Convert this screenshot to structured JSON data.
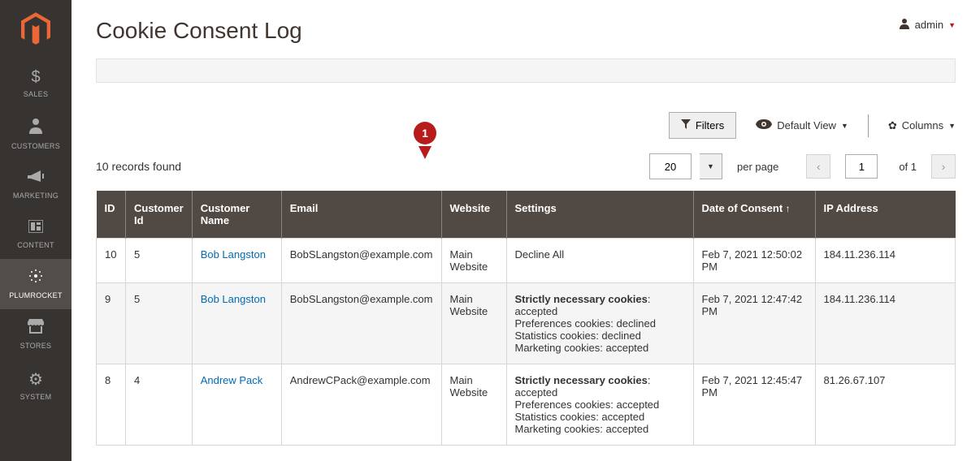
{
  "sidebar": {
    "items": [
      {
        "label": "Sales",
        "icon": "dollar"
      },
      {
        "label": "Customers",
        "icon": "person"
      },
      {
        "label": "Marketing",
        "icon": "megaphone"
      },
      {
        "label": "Content",
        "icon": "content"
      },
      {
        "label": "Plumrocket",
        "icon": "plumrocket"
      },
      {
        "label": "Stores",
        "icon": "store"
      },
      {
        "label": "System",
        "icon": "gear"
      }
    ],
    "active_index": 4
  },
  "header": {
    "title": "Cookie Consent Log",
    "user": "admin"
  },
  "toolbar": {
    "filters_label": "Filters",
    "default_view_label": "Default View",
    "columns_label": "Columns"
  },
  "pager": {
    "records_found": "10 records found",
    "page_size": "20",
    "per_page_label": "per page",
    "current_page": "1",
    "of_label": "of 1"
  },
  "table": {
    "columns": [
      "ID",
      "Customer Id",
      "Customer Name",
      "Email",
      "Website",
      "Settings",
      "Date of Consent",
      "IP Address"
    ],
    "sorted_col": 6,
    "rows": [
      {
        "id": "10",
        "customer_id": "5",
        "customer_name": "Bob Langston",
        "email": "BobSLangston@example.com",
        "website": "Main Website",
        "settings_bold": "",
        "settings_text": "Decline All",
        "date": "Feb 7, 2021 12:50:02 PM",
        "ip": "184.11.236.114",
        "settings_simple": true
      },
      {
        "id": "9",
        "customer_id": "5",
        "customer_name": "Bob Langston",
        "email": "BobSLangston@example.com",
        "website": "Main Website",
        "settings_lines": [
          {
            "bold": "Strictly necessary cookies",
            "rest": ": accepted"
          },
          {
            "bold": "",
            "rest": "Preferences cookies: declined"
          },
          {
            "bold": "",
            "rest": "Statistics cookies: declined"
          },
          {
            "bold": "",
            "rest": "Marketing cookies: accepted"
          }
        ],
        "date": "Feb 7, 2021 12:47:42 PM",
        "ip": "184.11.236.114"
      },
      {
        "id": "8",
        "customer_id": "4",
        "customer_name": "Andrew Pack",
        "email": "AndrewCPack@example.com",
        "website": "Main Website",
        "settings_lines": [
          {
            "bold": "Strictly necessary cookies",
            "rest": ": accepted"
          },
          {
            "bold": "",
            "rest": "Preferences cookies: accepted"
          },
          {
            "bold": "",
            "rest": "Statistics cookies: accepted"
          },
          {
            "bold": "",
            "rest": "Marketing cookies: accepted"
          }
        ],
        "date": "Feb 7, 2021 12:45:47 PM",
        "ip": "81.26.67.107"
      }
    ]
  },
  "marker": {
    "label": "1"
  }
}
